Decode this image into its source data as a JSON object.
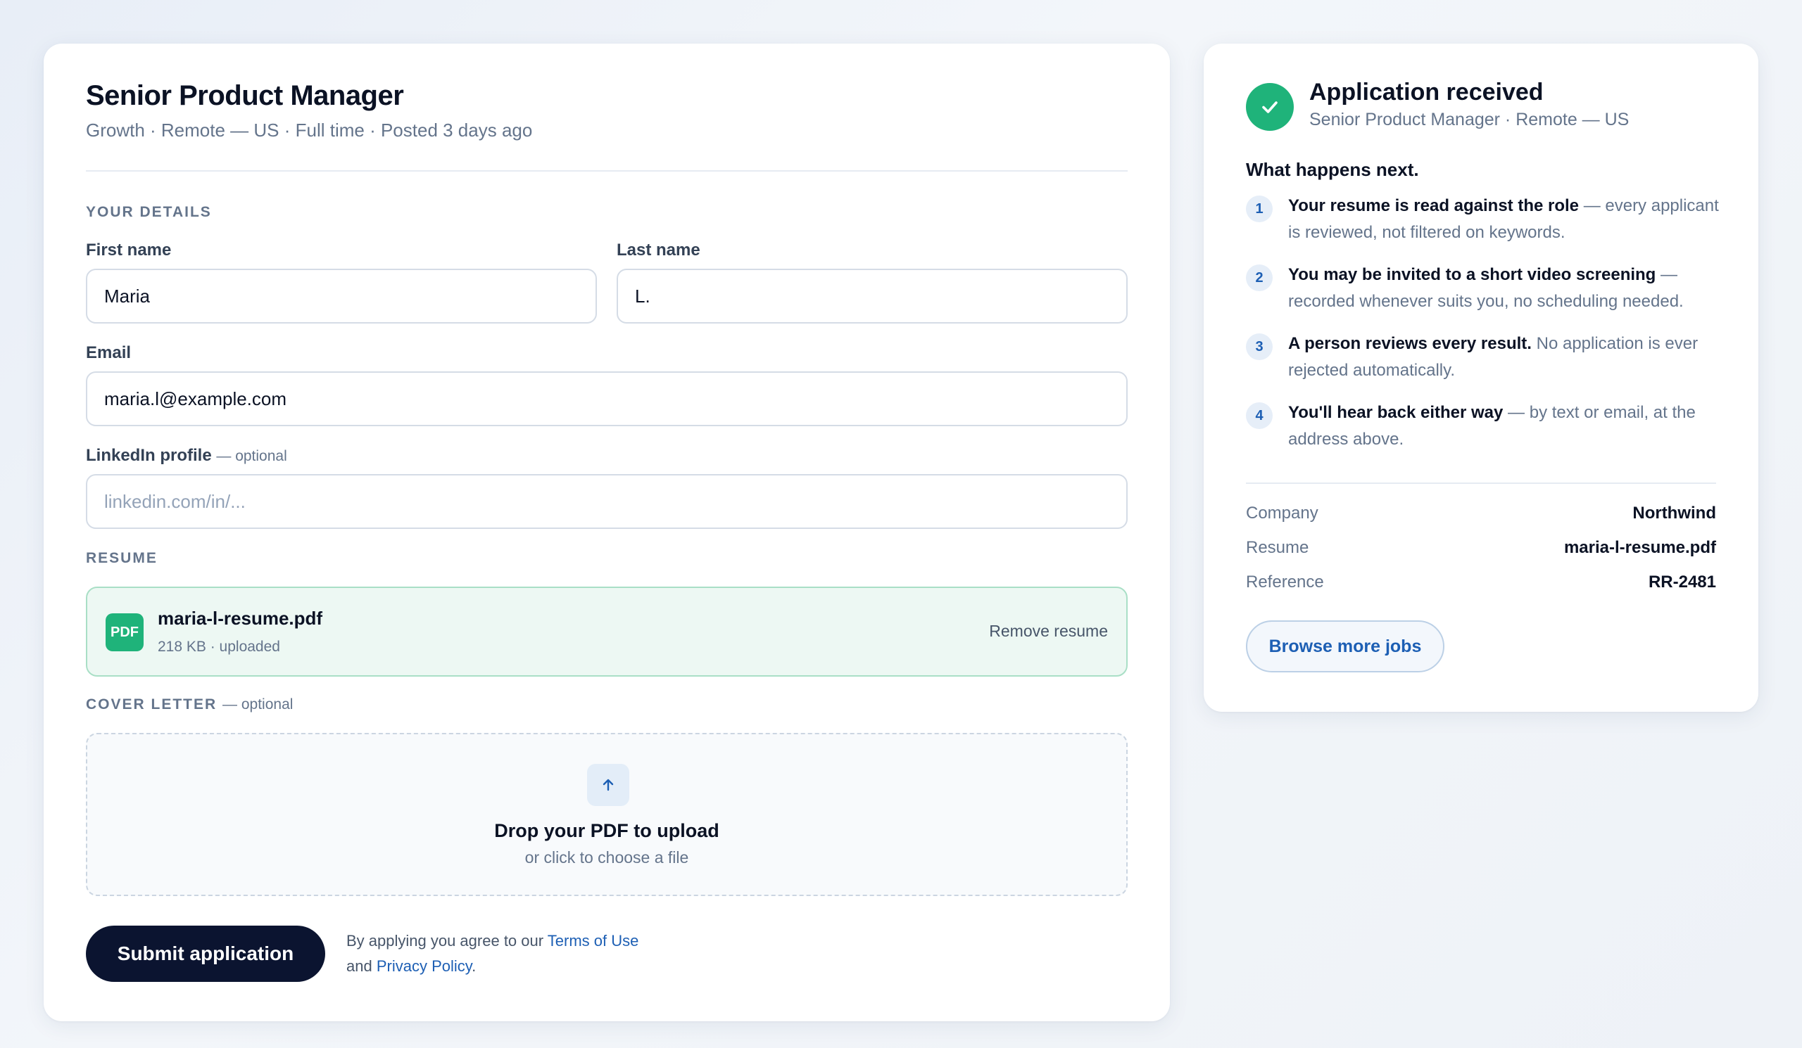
{
  "job": {
    "title": "Senior Product Manager",
    "meta": "Growth · Remote — US · Full time · Posted 3 days ago"
  },
  "form": {
    "details_section": "YOUR DETAILS",
    "first_name": {
      "label": "First name",
      "value": "Maria"
    },
    "last_name": {
      "label": "Last name",
      "value": "L."
    },
    "email": {
      "label": "Email",
      "value": "maria.l@example.com"
    },
    "linkedin": {
      "label": "LinkedIn profile",
      "optional": "— optional",
      "value": "",
      "placeholder": "linkedin.com/in/..."
    },
    "resume_section": "RESUME",
    "resume": {
      "badge": "PDF",
      "file_name": "maria-l-resume.pdf",
      "file_meta": "218 KB · uploaded",
      "remove_label": "Remove resume"
    },
    "cover_section": "COVER LETTER",
    "cover_optional": "— optional",
    "cover_drop": {
      "icon": "arrow-up-icon",
      "title": "Drop your PDF to upload",
      "subtitle": "or click to choose a file"
    },
    "submit_label": "Submit application",
    "terms": {
      "prefix": "By applying you agree to our ",
      "terms_link": "Terms of Use",
      "middle": "and ",
      "privacy_link": "Privacy Policy",
      "suffix": "."
    }
  },
  "status": {
    "title": "Application received",
    "subtitle": "Senior Product Manager · Remote — US",
    "next_heading": "What happens next.",
    "steps": [
      {
        "num": "1",
        "bold": "Your resume is read against the role",
        "rest": " — every applicant is reviewed, not filtered on keywords."
      },
      {
        "num": "2",
        "bold": "You may be invited to a short video screening",
        "rest": " — recorded whenever suits you, no scheduling needed."
      },
      {
        "num": "3",
        "bold": "A person reviews every result.",
        "rest": " No application is ever rejected automatically."
      },
      {
        "num": "4",
        "bold": "You'll hear back either way",
        "rest": " — by text or email, at the address above."
      }
    ],
    "summary": [
      {
        "key": "Company",
        "value": "Northwind"
      },
      {
        "key": "Resume",
        "value": "maria-l-resume.pdf"
      },
      {
        "key": "Reference",
        "value": "RR-2481"
      }
    ],
    "browse_label": "Browse more jobs"
  },
  "colors": {
    "accent": "#1d5fb4",
    "success": "#1fb37a",
    "primary_button": "#0b1430"
  }
}
